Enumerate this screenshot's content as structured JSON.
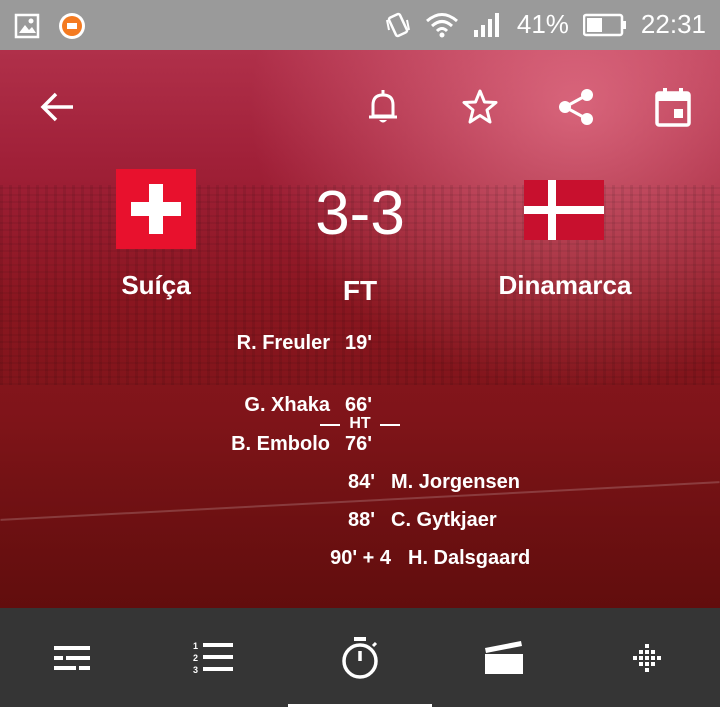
{
  "status_bar": {
    "battery": "41%",
    "time": "22:31",
    "icons": [
      "gallery-icon",
      "app-icon",
      "vibrate-icon",
      "wifi-icon",
      "signal-icon",
      "battery-icon"
    ]
  },
  "toolbar": {
    "icons": [
      "back-arrow-icon",
      "bell-icon",
      "star-icon",
      "share-icon",
      "calendar-icon"
    ]
  },
  "match": {
    "home_team": "Suíça",
    "away_team": "Dinamarca",
    "score": "3-3",
    "status": "FT",
    "halftime_label": "HT",
    "events": {
      "home": [
        {
          "player": "R. Freuler",
          "minute": "19'"
        },
        {
          "player": "G. Xhaka",
          "minute": "66'"
        },
        {
          "player": "B. Embolo",
          "minute": "76'"
        }
      ],
      "away": [
        {
          "minute": "84'",
          "player": "M. Jorgensen"
        },
        {
          "minute": "88'",
          "player": "C. Gytkjaer"
        },
        {
          "minute": "90' + 4",
          "player": "H. Dalsgaard"
        }
      ]
    }
  },
  "bottom_nav": {
    "tabs": [
      "lineups-icon",
      "list-icon",
      "timer-icon",
      "video-icon",
      "grid-icon"
    ],
    "active_index": 2
  },
  "colors": {
    "swiss_red": "#e8112d",
    "danish_red": "#c8102e",
    "hero_tint": "#8a1620"
  }
}
